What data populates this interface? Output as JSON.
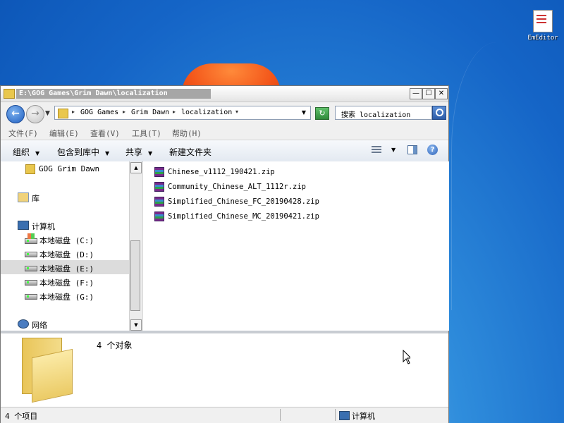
{
  "desktop": {
    "icon_label": "EmEditor"
  },
  "window": {
    "title": "E:\\GOG Games\\Grim Dawn\\localization",
    "minimize": "—",
    "maximize": "☐",
    "close": "✕"
  },
  "address": {
    "back": "←",
    "forward": "→",
    "crumbs": [
      "GOG Games",
      "Grim Dawn",
      "localization"
    ],
    "refresh": "↻",
    "search_placeholder": "搜索 localization"
  },
  "menu": [
    "文件(F)",
    "编辑(E)",
    "查看(V)",
    "工具(T)",
    "帮助(H)"
  ],
  "toolbar": {
    "organize": "组织",
    "include_library": "包含到库中",
    "share": "共享",
    "new_folder": "新建文件夹",
    "help": "?"
  },
  "nav": {
    "items": [
      {
        "label": "GOG Grim Dawn",
        "icon": "folder-icon"
      },
      {
        "label": "库",
        "icon": "library-icon"
      },
      {
        "label": "计算机",
        "icon": "computer-icon"
      },
      {
        "label": "本地磁盘 (C:)",
        "icon": "system-drive-icon"
      },
      {
        "label": "本地磁盘 (D:)",
        "icon": "drive-icon"
      },
      {
        "label": "本地磁盘 (E:)",
        "icon": "drive-icon",
        "selected": true
      },
      {
        "label": "本地磁盘 (F:)",
        "icon": "drive-icon"
      },
      {
        "label": "本地磁盘 (G:)",
        "icon": "drive-icon"
      },
      {
        "label": "网络",
        "icon": "network-icon"
      }
    ]
  },
  "files": [
    {
      "name": "Chinese_v1112_190421.zip",
      "icon": "zip-icon"
    },
    {
      "name": "Community_Chinese_ALT_1112r.zip",
      "icon": "zip-icon"
    },
    {
      "name": "Simplified_Chinese_FC_20190428.zip",
      "icon": "zip-icon"
    },
    {
      "name": "Simplified_Chinese_MC_20190421.zip",
      "icon": "zip-icon"
    }
  ],
  "details": {
    "count": "4 个对象"
  },
  "status": {
    "items": "4 个项目",
    "location": "计算机"
  }
}
